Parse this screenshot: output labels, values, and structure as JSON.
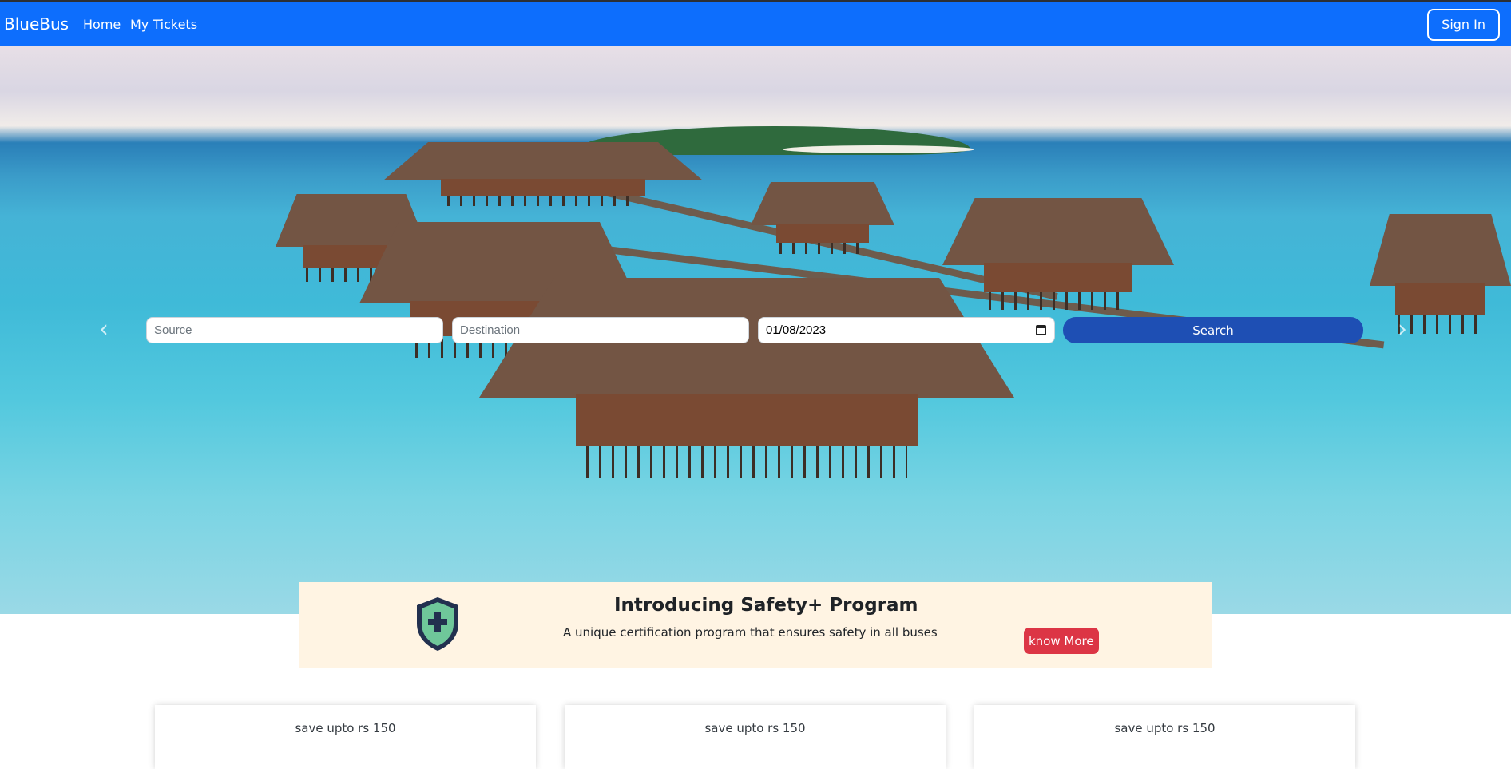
{
  "navbar": {
    "brand": "BlueBus",
    "links": [
      "Home",
      "My Tickets"
    ],
    "sign_in_label": "Sign In"
  },
  "search": {
    "source_placeholder": "Source",
    "destination_placeholder": "Destination",
    "date_value": "01/08/2023",
    "search_label": "Search"
  },
  "safety": {
    "title": "Introducing Safety+ Program",
    "subtitle": "A unique certification program that ensures safety in all buses",
    "button_label": "know More"
  },
  "offers": [
    {
      "text": "save upto rs 150"
    },
    {
      "text": "save upto rs 150"
    },
    {
      "text": "save upto rs 150"
    }
  ],
  "colors": {
    "navbar": "#0d6efd",
    "search_button": "#1e4fb4",
    "know_more_button": "#dc3545",
    "safety_banner": "#fff4e3"
  },
  "icons": {
    "shield": "shield-plus-icon",
    "calendar": "calendar-icon",
    "prev": "chevron-left-icon",
    "next": "chevron-right-icon"
  }
}
